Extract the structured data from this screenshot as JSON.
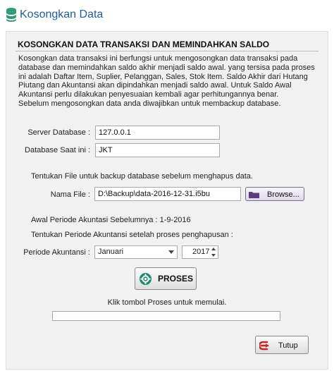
{
  "window": {
    "title": "Kosongkan Data",
    "title_icon": "database-icon"
  },
  "heading": "KOSONGKAN DATA TRANSAKSI DAN MEMINDAHKAN SALDO",
  "description": [
    "Kosongkan data transaksi ini berfungsi untuk mengosongkan data transaksi pada",
    "database dan memindahkan saldo akhir menjadi saldo awal. yang tersisa pada proses",
    "ini adalah Daftar Item, Suplier, Pelanggan, Sales, Stok Item. Saldo Akhir dari Hutang",
    "Piutang dan Akuntansi akan dipindahkan menjadi saldo awal. Untuk Saldo Awal",
    "Akuntansi perlu dilakukan penyesuaian kembali agar perhitungannya benar.",
    "Sebelum mengosongkan data anda diwajibkan untuk membackup database."
  ],
  "server": {
    "label": "Server Database :",
    "value": "127.0.0.1"
  },
  "database": {
    "label": "Database Saat ini :",
    "value": "JKT"
  },
  "backup": {
    "instruction": "Tentukan File untuk backup database sebelum menghapus data.",
    "file_label": "Nama File :",
    "file_value": "D:\\Backup\\data-2016-12-31.i5bu",
    "browse_label": "Browse...",
    "browse_icon": "folder-icon"
  },
  "period": {
    "previous": "Awal Periode Akuntasi Sebelumnya : 1-9-2016",
    "instruction": "Tentukan Periode Akuntansi setelah proses penghapusan :",
    "label": "Periode Akuntansi :",
    "month": "Januari",
    "year": "2017"
  },
  "proses_button": {
    "label": "PROSES",
    "icon": "gear-icon"
  },
  "hint": "Klik tombol Proses untuk memulai.",
  "progress": 0,
  "tutup_button": {
    "label": "Tutup",
    "icon": "exit-icon"
  },
  "colors": {
    "title": "#1e5e9e",
    "gear": "#1f8a70",
    "exit": "#c62828",
    "folder": "#5a3d7a"
  }
}
